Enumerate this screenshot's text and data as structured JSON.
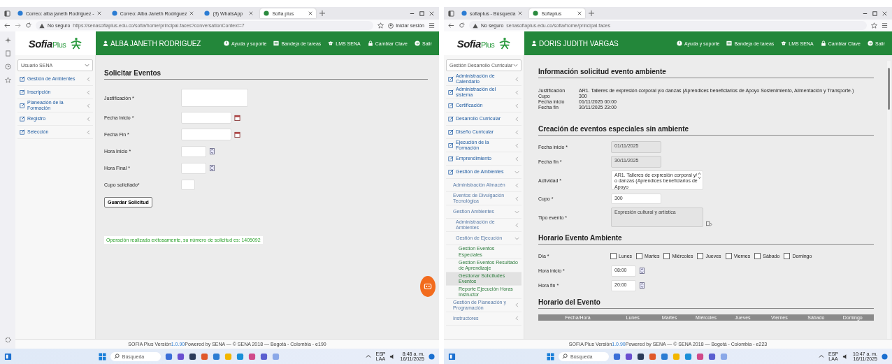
{
  "screens": [
    {
      "browser": {
        "side_panel": true,
        "tabs": [
          {
            "label": "Correo: alba janeth Rodriguez -",
            "selected": false
          },
          {
            "label": "Correo: Alba Janeth Rodriguez",
            "selected": false
          },
          {
            "label": "(3) WhatsApp",
            "selected": false
          },
          {
            "label": "Sofia plus",
            "selected": true
          }
        ],
        "security": "No seguro",
        "url": "https://senasofiaplus.edu.co/sofia/home/principal.faces?conversationContext=7",
        "profile": "Iniciar sesión"
      },
      "logo": {
        "word": "Sofia",
        "suffix": "Plus"
      },
      "header": {
        "user": "ALBA JANETH RODRIGUEZ",
        "links": [
          "Ayuda y soporte",
          "Bandeja de tareas",
          "LMS SENA",
          "Cambiar Clave",
          "Salir"
        ]
      },
      "sidebar": {
        "select": "Usuario SENA",
        "items": [
          {
            "label": "Gestión de Ambientes",
            "expanded": false,
            "selected": false
          },
          {
            "label": "Inscripción",
            "expanded": false,
            "selected": false
          },
          {
            "label": "Planeación de la Formación",
            "expanded": false,
            "selected": false
          },
          {
            "label": "Registro",
            "expanded": false,
            "selected": false
          },
          {
            "label": "Selección",
            "expanded": false,
            "selected": false
          }
        ]
      },
      "content": [
        {
          "kind": "heading",
          "text": "Solicitar Eventos"
        },
        {
          "kind": "textarea",
          "label": "Justificación *",
          "disabled": false
        },
        {
          "kind": "date",
          "label": "Fecha Inicio *",
          "disabled": false
        },
        {
          "kind": "date",
          "label": "Fecha Fin *",
          "disabled": false
        },
        {
          "kind": "time",
          "label": "Hora Inicio *",
          "disabled": false
        },
        {
          "kind": "time",
          "label": "Hora Final *",
          "disabled": false
        },
        {
          "kind": "number",
          "label": "Cupo solicitado*",
          "disabled": false
        },
        {
          "kind": "button",
          "label": "Guardar Solicitud"
        },
        {
          "kind": "message",
          "text": "Operación realizada exitosamente, su número de solicitud es: 1405092"
        }
      ],
      "chat_button": true,
      "footer": {
        "before": "SOFIA Plus Versión ",
        "version": "1.0.90",
        "after": " Powered by SENA — © SENA 2018 — Bogotá - Colombia - e190"
      },
      "taskbar": {
        "search": "Búsqueda",
        "lang": "ESP",
        "region": "LAA",
        "time": "8:48 a. m.",
        "date": "16/11/2025"
      }
    },
    {
      "browser": {
        "side_panel": false,
        "tabs": [
          {
            "label": "sofiaplus - Búsqueda",
            "selected": false
          },
          {
            "label": "Sofiaplus",
            "selected": true
          }
        ],
        "security": "No seguro",
        "url": "senasofiaplus.edu.co/sofia/home/principal.faces"
      },
      "logo": {
        "word": "Sofia",
        "suffix": "Plus"
      },
      "header": {
        "user": "DORIS JUDITH VARGAS",
        "links": [
          "Ayuda y soporte",
          "Bandeja de tareas",
          "LMS SENA",
          "Cambiar Clave",
          "Salir"
        ]
      },
      "sidebar": {
        "select": "Gestión Desarrollo Curricular",
        "items": [
          {
            "label": "Administración de Calendario",
            "expanded": false,
            "selected": false
          },
          {
            "label": "Administración del sistema",
            "expanded": false,
            "selected": false
          },
          {
            "label": "Certificación",
            "expanded": false,
            "selected": false
          },
          {
            "label": "Desarrollo Curricular",
            "expanded": false,
            "selected": false
          },
          {
            "label": "Diseño Curricular",
            "expanded": false,
            "selected": false
          },
          {
            "label": "Ejecución de la Formación",
            "expanded": false,
            "selected": false
          },
          {
            "label": "Emprendimiento",
            "expanded": false,
            "selected": false
          },
          {
            "label": "Gestión de Ambientes",
            "expanded": true,
            "selected": false,
            "children": [
              {
                "label": "Administración Almacén",
                "expanded": false,
                "selected": false
              },
              {
                "label": "Eventos de Divulgación Tecnológica",
                "expanded": false,
                "selected": false
              },
              {
                "label": "Gestion Ambientes",
                "expanded": true,
                "selected": false,
                "children": [
                  {
                    "label": "Administración de Ambientes",
                    "expanded": false,
                    "selected": false
                  },
                  {
                    "label": "Gestión de Ejecución",
                    "expanded": true,
                    "selected": false,
                    "children": [
                      {
                        "label": "Gestion Eventos Especiales",
                        "selected": false
                      },
                      {
                        "label": "Gestion Eventos Resultado de Aprendizaje",
                        "selected": false
                      },
                      {
                        "label": "Gestionar Solicitudes Eventos",
                        "selected": true
                      },
                      {
                        "label": "Reporte Ejecución Horas Instructor",
                        "selected": false
                      }
                    ]
                  }
                ]
              },
              {
                "label": "Gestión de Planeación y Programación",
                "expanded": false,
                "selected": false
              },
              {
                "label": "Instructores",
                "expanded": false,
                "selected": false
              }
            ]
          }
        ]
      },
      "content": [
        {
          "kind": "heading",
          "text": "Información solicitud evento ambiente"
        },
        {
          "kind": "info",
          "rows": [
            {
              "label": "Justificación",
              "value": "AR1. Talleres de expresión corporal y/o danzas (Aprendices beneficiarios de Apoyo Sostenimiento, Alimentación y Transporte.)"
            },
            {
              "label": "Cupo",
              "value": "300"
            },
            {
              "label": "Fecha inicio",
              "value": "01/11/2025 00:00"
            },
            {
              "label": "Fecha fin",
              "value": "30/11/2025 23:00"
            }
          ]
        },
        {
          "kind": "heading",
          "text": "Creación de eventos especiales sin ambiente"
        },
        {
          "kind": "date",
          "label": "Fecha inicio *",
          "value": "01/11/2025",
          "disabled": true
        },
        {
          "kind": "date",
          "label": "Fecha fin *",
          "value": "30/11/2025",
          "disabled": true
        },
        {
          "kind": "textarea",
          "label": "Actividad *",
          "value": "AR1. Talleres de expresión corporal y/ o danzas (Aprendices beneficiarios de Apoyo",
          "disabled": false
        },
        {
          "kind": "text",
          "label": "Cupo *",
          "value": "300",
          "disabled": false
        },
        {
          "kind": "picker",
          "label": "Tipo evento *",
          "value": "Expresión cultural y artística",
          "disabled": true
        },
        {
          "kind": "heading",
          "text": "Horario Evento Ambiente"
        },
        {
          "kind": "days",
          "label": "Día *",
          "days": [
            {
              "label": "Lunes",
              "checked": false
            },
            {
              "label": "Martes",
              "checked": false
            },
            {
              "label": "Miércoles",
              "checked": false
            },
            {
              "label": "Jueves",
              "checked": false
            },
            {
              "label": "Viernes",
              "checked": false
            },
            {
              "label": "Sábado",
              "checked": false
            },
            {
              "label": "Domingo",
              "checked": false
            }
          ]
        },
        {
          "kind": "time",
          "label": "Hora inicio *",
          "value": "08:00",
          "disabled": false
        },
        {
          "kind": "time",
          "label": "Hora fin *",
          "value": "20:00",
          "disabled": false
        },
        {
          "kind": "heading",
          "text": "Horario del Evento"
        },
        {
          "kind": "table",
          "columns": [
            "Fecha/Hora",
            "Lunes",
            "Martes",
            "Miércoles",
            "Jueves",
            "Viernes",
            "Sábado",
            "Domingo"
          ]
        }
      ],
      "footer": {
        "before": "SOFIA Plus Versión ",
        "version": "1.0.90",
        "after": " Powered by SENA — © SENA 2018 — Bogotá - Colombia - e223"
      },
      "taskbar": {
        "search": "Búsqueda",
        "lang": "ESP",
        "region": "LAA",
        "time": "10:47 a. m.",
        "date": "16/11/2025"
      }
    }
  ]
}
